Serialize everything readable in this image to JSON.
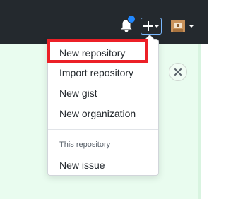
{
  "header": {
    "notification_icon": "bell-icon",
    "notification_dot_color": "#2188ff",
    "create_button_icon": "plus-icon",
    "avatar_icon": "user-avatar"
  },
  "page": {
    "close_icon": "close-icon"
  },
  "create_menu": {
    "items": [
      {
        "label": "New repository"
      },
      {
        "label": "Import repository"
      },
      {
        "label": "New gist"
      },
      {
        "label": "New organization"
      }
    ],
    "section_header": "This repository",
    "section_items": [
      {
        "label": "New issue"
      }
    ]
  },
  "highlight": {
    "color": "#ec2027",
    "target": "New repository"
  }
}
